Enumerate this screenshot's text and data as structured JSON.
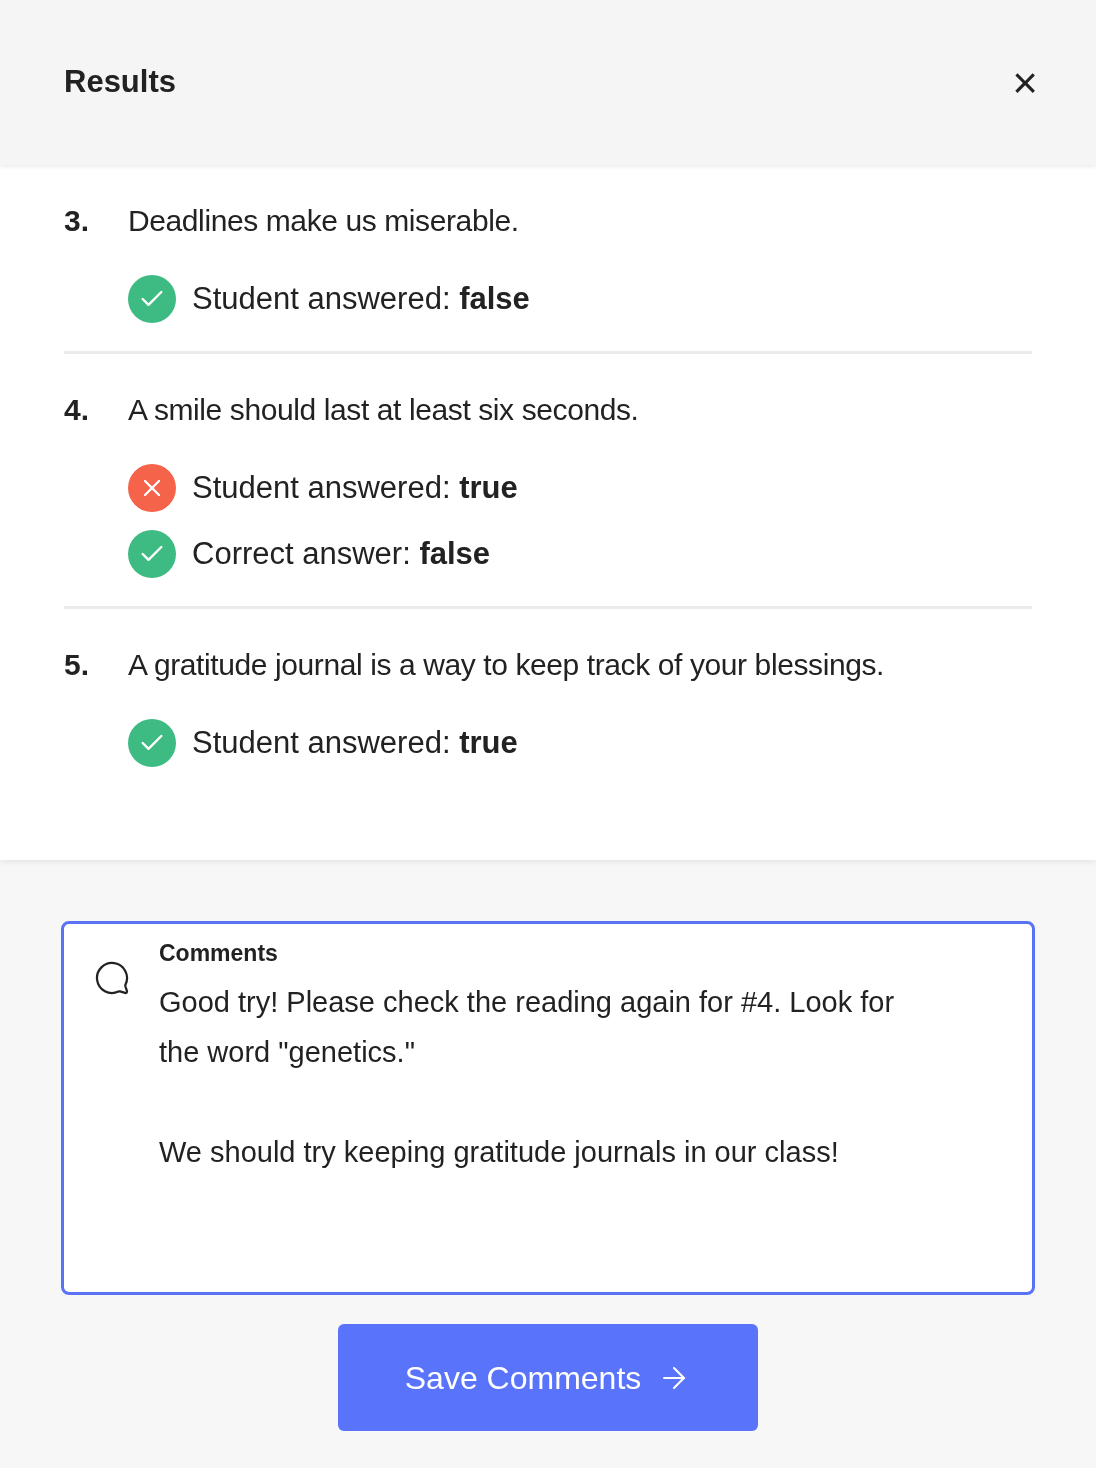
{
  "header": {
    "title": "Results",
    "close_icon": "×"
  },
  "questions": [
    {
      "number": "3.",
      "text": "Deadlines make us miserable.",
      "answers": [
        {
          "kind": "correct",
          "text": "Student answered: **false**"
        }
      ]
    },
    {
      "number": "4.",
      "text": "A smile should last at least six seconds.",
      "answers": [
        {
          "kind": "incorrect",
          "text": "Student answered: **true**"
        },
        {
          "kind": "correct",
          "text": "Correct answer: **false**"
        }
      ]
    },
    {
      "number": "5.",
      "text": "A gratitude journal is a way to keep track of your blessings.",
      "answers": [
        {
          "kind": "correct",
          "text": "Student answered: **true**"
        }
      ]
    }
  ],
  "comments": {
    "label": "Comments",
    "value": "Good try! Please check the reading again for #4. Look for the word \"genetics.\"\n\nWe should try keeping gratitude journals in our class!"
  },
  "save_button": {
    "label": "Save Comments"
  }
}
